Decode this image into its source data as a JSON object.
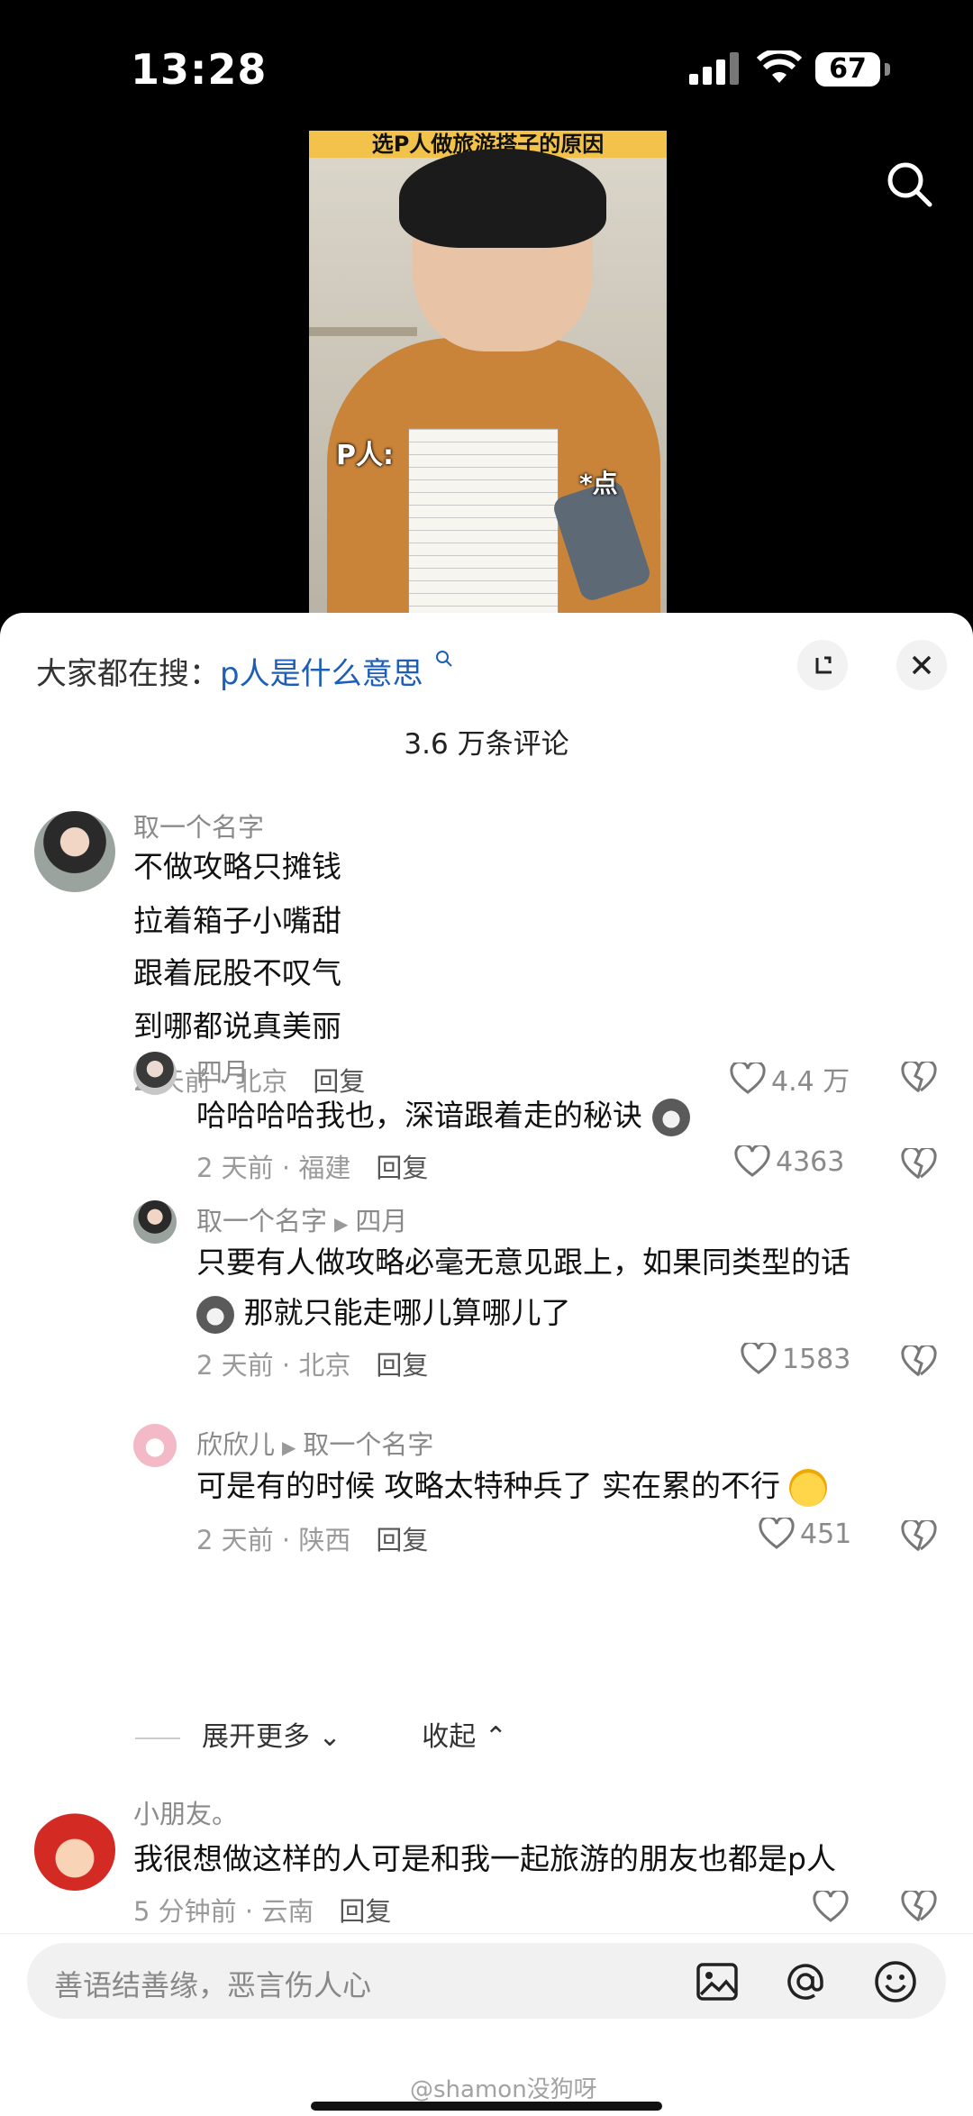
{
  "status": {
    "time": "13:28",
    "battery": "67"
  },
  "video": {
    "title_overlay": "选P人做旅游搭子的原因",
    "label_p": "P人:",
    "label_dot": "*点"
  },
  "icons": {
    "search": "search-icon",
    "expand": "expand-icon",
    "close": "close-icon",
    "like": "heart-icon",
    "dislike": "broken-heart-icon"
  },
  "sheet": {
    "search_prefix": "大家都在搜：",
    "search_term": "p人是什么意思",
    "comment_count": "3.6 万条评论"
  },
  "comments": [
    {
      "user": "取一个名字",
      "lines": [
        "不做攻略只摊钱",
        "拉着箱子小嘴甜",
        "跟着屁股不叹气",
        "到哪都说真美丽"
      ],
      "time": "2 天前 · 北京",
      "reply": "回复",
      "likes": "4.4 万"
    },
    {
      "user": "四月",
      "lines": [
        "哈哈哈哈我也，深谙跟着走的秘诀"
      ],
      "time": "2 天前 · 福建",
      "reply": "回复",
      "likes": "4363"
    },
    {
      "user": "取一个名字",
      "reply_to": "四月",
      "lines": [
        "只要有人做攻略必毫无意见跟上，如果同类型的话",
        "那就只能走哪儿算哪儿了"
      ],
      "time": "2 天前 · 北京",
      "reply": "回复",
      "likes": "1583"
    },
    {
      "user": "欣欣儿",
      "reply_to": "取一个名字",
      "lines": [
        "可是有的时候 攻略太特种兵了 实在累的不行"
      ],
      "time": "2 天前 · 陕西",
      "reply": "回复",
      "likes": "451"
    },
    {
      "user": "小朋友。",
      "lines": [
        "我很想做这样的人可是和我一起旅游的朋友也都是p人"
      ],
      "time": "5 分钟前 · 云南",
      "reply": "回复",
      "likes": ""
    }
  ],
  "thread": {
    "expand_more": "展开更多",
    "collapse": "收起"
  },
  "input": {
    "placeholder": "善语结善缘，恶言伤人心"
  },
  "watermark": "@shamon没狗呀"
}
